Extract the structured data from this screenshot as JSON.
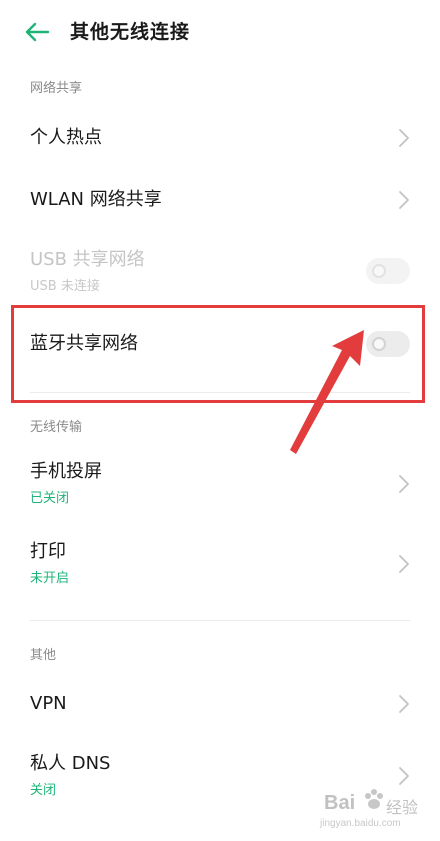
{
  "header": {
    "title": "其他无线连接",
    "back_icon": "arrow-left-icon"
  },
  "colors": {
    "accent": "#1fb37a",
    "annotation": "#e23c3c"
  },
  "sections": [
    {
      "header": "网络共享",
      "items": [
        {
          "title": "个人热点",
          "control": "chevron"
        },
        {
          "title": "WLAN 网络共享",
          "control": "chevron"
        },
        {
          "title": "USB 共享网络",
          "subtitle": "USB 未连接",
          "control": "toggle",
          "toggle_on": false,
          "disabled": true
        },
        {
          "title": "蓝牙共享网络",
          "control": "toggle",
          "toggle_on": false,
          "highlighted": true
        }
      ]
    },
    {
      "header": "无线传输",
      "items": [
        {
          "title": "手机投屏",
          "subtitle": "已关闭",
          "control": "chevron"
        },
        {
          "title": "打印",
          "subtitle": "未开启",
          "control": "chevron"
        }
      ]
    },
    {
      "header": "其他",
      "items": [
        {
          "title": "VPN",
          "control": "chevron"
        },
        {
          "title": "私人 DNS",
          "subtitle": "关闭",
          "control": "chevron"
        }
      ]
    }
  ],
  "watermark": {
    "logo_text": "Bai",
    "sub": "经验",
    "url": "jingyan.baidu.com",
    "icon": "paw-icon"
  }
}
